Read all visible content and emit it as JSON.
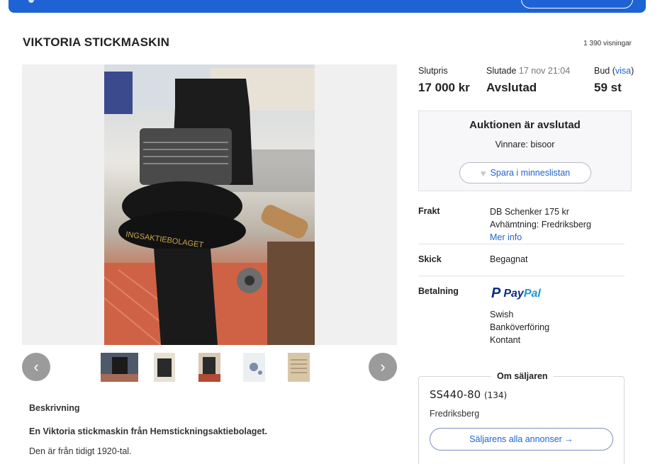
{
  "listing": {
    "title": "VIKTORIA STICKMASKIN",
    "views": "1 390 visningar"
  },
  "stats": {
    "final_price_label": "Slutpris",
    "final_price_value": "17 000 kr",
    "ended_label": "Slutade",
    "ended_date": "17 nov 21:04",
    "ended_value": "Avslutad",
    "bids_label": "Bud",
    "bids_open": "(",
    "bids_link": "visa",
    "bids_close": ")",
    "bids_value": "59 st"
  },
  "auction_status": {
    "title": "Auktionen är avslutad",
    "winner": "Vinnare: bisoor",
    "save_label": "Spara i minneslistan"
  },
  "shipping": {
    "label": "Frakt",
    "line1": "DB Schenker 175 kr",
    "pickup_label": "Avhämtning: ",
    "pickup_city": "Fredriksberg",
    "more_info": "Mer info"
  },
  "condition": {
    "label": "Skick",
    "value": "Begagnat"
  },
  "payment": {
    "label": "Betalning",
    "paypal_a": "Pay",
    "paypal_b": "Pal",
    "methods": [
      "Swish",
      "Banköverföring",
      "Kontant"
    ]
  },
  "seller": {
    "section_title": "Om säljaren",
    "name": "SS440-80",
    "rating": "(134)",
    "city": "Fredriksberg",
    "all_ads": "Säljarens alla annonser →"
  },
  "description": {
    "heading": "Beskrivning",
    "bold_line": "En Viktoria stickmaskin från Hemstickningsaktiebolaget.",
    "text": "Den är från tidigt 1920-tal."
  },
  "gallery": {
    "prev_icon": "chevron-left-icon",
    "next_icon": "chevron-right-icon",
    "thumbnail_count": 5
  },
  "colors": {
    "brand_blue": "#1e63d4",
    "paypal_dark": "#0d2e7f",
    "paypal_light": "#1b9ad8"
  }
}
